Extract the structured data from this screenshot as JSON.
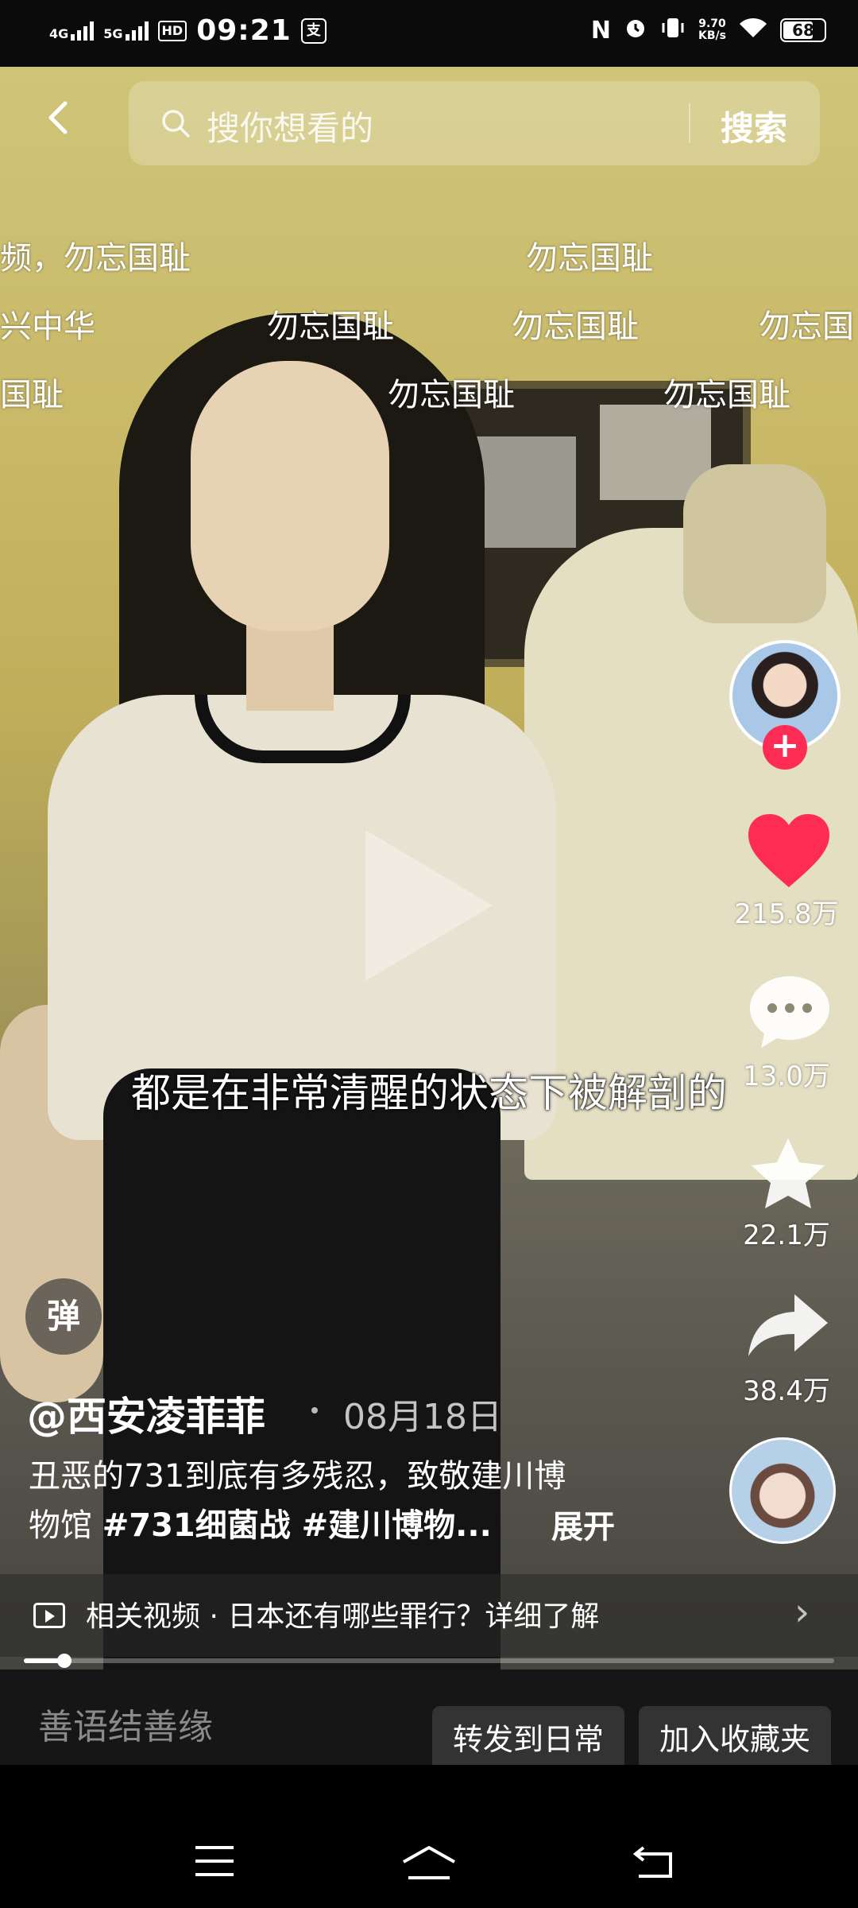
{
  "status_bar": {
    "network_1": "4G",
    "network_2": "5G",
    "hd_badge": "HD",
    "time": "09:21",
    "app_badge": "支",
    "nfc": "N",
    "speed_value": "9.70",
    "speed_unit": "KB/s",
    "battery": "68"
  },
  "search": {
    "placeholder": "搜你想看的",
    "button": "搜索"
  },
  "danmu": [
    "频，勿忘国耻",
    "勿忘国耻",
    "兴中华",
    "勿忘国耻",
    "勿忘国耻",
    "勿忘国",
    "国耻",
    "勿忘国耻",
    "勿忘国耻"
  ],
  "subtitle": "都是在非常清醒的状态下被解剖的",
  "actions": {
    "likes": "215.8万",
    "comments": "13.0万",
    "favorites": "22.1万",
    "shares": "38.4万",
    "follow_symbol": "+"
  },
  "danmu_toggle": "弹",
  "post": {
    "author": "@西安凌菲菲",
    "date": "08月18日",
    "desc_line1": "丑恶的731到底有多残忍，致敬建川博",
    "desc_line2_prefix": "物馆 ",
    "tag1": "#731细菌战",
    "tag2": " #建川博物...",
    "expand": "展开"
  },
  "related": {
    "text": "相关视频 · 日本还有哪些罪行？详细了解",
    "chevron": "›"
  },
  "progress": {
    "fraction": 0.05
  },
  "comment_bar": {
    "placeholder": "善语结善缘",
    "btn_repost": "转发到日常",
    "btn_collect": "加入收藏夹"
  },
  "colors": {
    "like": "#fe2c55",
    "follow": "#fe2c55"
  }
}
